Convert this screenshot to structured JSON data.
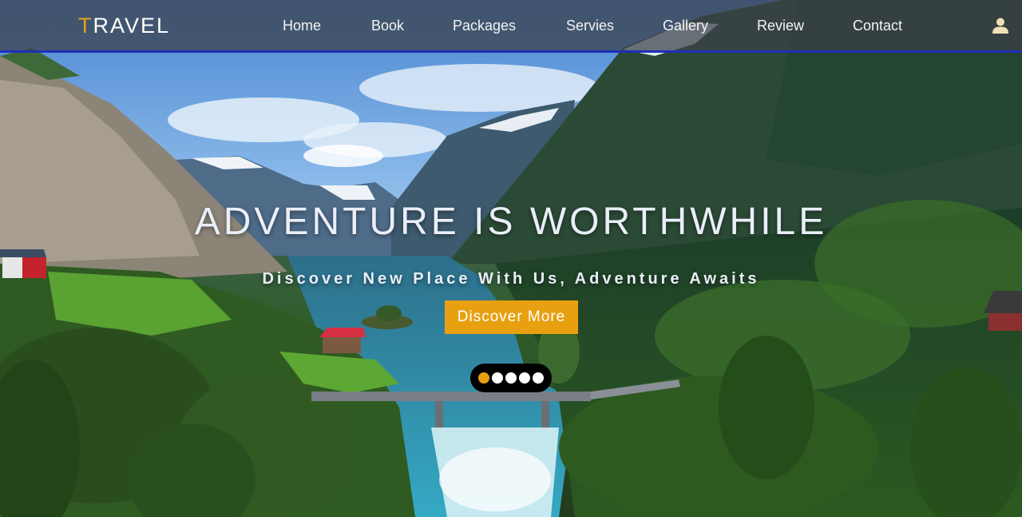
{
  "logo": {
    "first_letter": "T",
    "rest": "RAVEL"
  },
  "nav": {
    "items": [
      {
        "label": "Home"
      },
      {
        "label": "Book"
      },
      {
        "label": "Packages"
      },
      {
        "label": "Servies"
      },
      {
        "label": "Gallery"
      },
      {
        "label": "Review"
      },
      {
        "label": "Contact"
      }
    ],
    "user_icon": "user-icon"
  },
  "hero": {
    "headline": "ADVENTURE IS WORTHWHILE",
    "subhead": "Discover New Place With Us, Adventure Awaits",
    "cta_label": "Discover More",
    "slide_count": 5,
    "active_slide": 1
  },
  "colors": {
    "accent": "#e8a011",
    "nav_bg": "#3c4048",
    "nav_border": "#1f2fb8",
    "text": "#e9eef8"
  }
}
